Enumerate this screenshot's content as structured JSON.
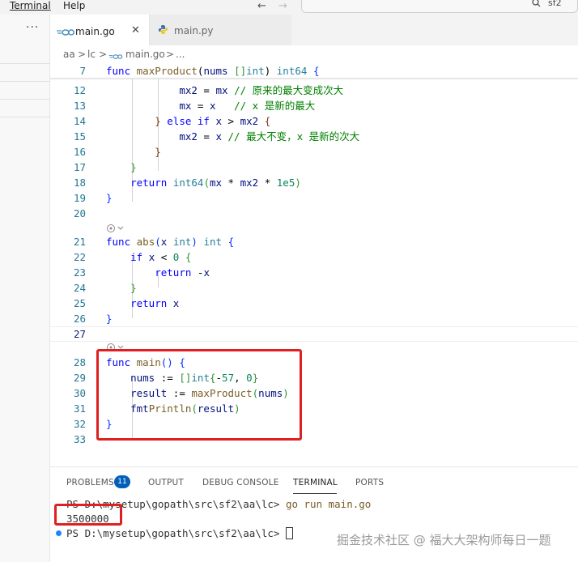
{
  "menubar": {
    "items": [
      "Terminal",
      "Help"
    ],
    "back_arrow": "←",
    "forward_arrow": "→",
    "search_text": "sf2"
  },
  "sidebar": {
    "more_label": "···"
  },
  "tabs": [
    {
      "label": "main.go",
      "icon": "go-file-icon",
      "close": "✕",
      "active": true
    },
    {
      "label": "main.py",
      "icon": "python-file-icon",
      "active": false
    }
  ],
  "breadcrumb": {
    "parts": [
      "aa",
      ">",
      "lc",
      ">",
      "main.go",
      ">",
      "..."
    ]
  },
  "editor": {
    "lines": [
      {
        "n": "7",
        "tokens": [
          [
            "kw",
            "func "
          ],
          [
            "fn",
            "maxProduct"
          ],
          [
            "",
            "("
          ],
          [
            "id",
            "nums "
          ],
          [
            "br2",
            "[]"
          ],
          [
            "ty",
            "int"
          ],
          [
            "",
            ") "
          ],
          [
            "ty",
            "int64 "
          ],
          [
            "br",
            "{"
          ]
        ]
      },
      {
        "n": "12",
        "tokens": [
          [
            "",
            "            "
          ],
          [
            "id",
            "mx2"
          ],
          [
            "",
            " = "
          ],
          [
            "id",
            "mx"
          ],
          [
            "",
            " "
          ],
          [
            "cm",
            "// 原来的最大变成次大"
          ]
        ]
      },
      {
        "n": "13",
        "tokens": [
          [
            "",
            "            "
          ],
          [
            "id",
            "mx"
          ],
          [
            "",
            " = "
          ],
          [
            "id",
            "x"
          ],
          [
            "",
            "   "
          ],
          [
            "cm",
            "// x 是新的最大"
          ]
        ]
      },
      {
        "n": "14",
        "tokens": [
          [
            "",
            "        "
          ],
          [
            "br3",
            "}"
          ],
          [
            "",
            " "
          ],
          [
            "kw",
            "else if "
          ],
          [
            "id",
            "x"
          ],
          [
            "",
            " > "
          ],
          [
            "id",
            "mx2"
          ],
          [
            "",
            " "
          ],
          [
            "br3",
            "{"
          ]
        ]
      },
      {
        "n": "15",
        "tokens": [
          [
            "",
            "            "
          ],
          [
            "id",
            "mx2"
          ],
          [
            "",
            " = "
          ],
          [
            "id",
            "x"
          ],
          [
            "",
            " "
          ],
          [
            "cm",
            "// 最大不变，x 是新的次大"
          ]
        ]
      },
      {
        "n": "16",
        "tokens": [
          [
            "",
            "        "
          ],
          [
            "br3",
            "}"
          ]
        ]
      },
      {
        "n": "17",
        "tokens": [
          [
            "",
            "    "
          ],
          [
            "br2",
            "}"
          ]
        ]
      },
      {
        "n": "18",
        "tokens": [
          [
            "",
            "    "
          ],
          [
            "kw",
            "return "
          ],
          [
            "ty",
            "int64"
          ],
          [
            "br2",
            "("
          ],
          [
            "id",
            "mx"
          ],
          [
            "",
            " * "
          ],
          [
            "id",
            "mx2"
          ],
          [
            "",
            " * "
          ],
          [
            "num",
            "1e5"
          ],
          [
            "br2",
            ")"
          ]
        ]
      },
      {
        "n": "19",
        "tokens": [
          [
            "br",
            "}"
          ]
        ]
      },
      {
        "n": "20",
        "tokens": []
      },
      {
        "n": "21",
        "tokens": [
          [
            "kw",
            "func "
          ],
          [
            "fn",
            "abs"
          ],
          [
            "br",
            "("
          ],
          [
            "id",
            "x "
          ],
          [
            "ty",
            "int"
          ],
          [
            "br",
            ") "
          ],
          [
            "ty",
            "int "
          ],
          [
            "br",
            "{"
          ]
        ]
      },
      {
        "n": "22",
        "tokens": [
          [
            "",
            "    "
          ],
          [
            "kw",
            "if "
          ],
          [
            "id",
            "x"
          ],
          [
            "",
            " < "
          ],
          [
            "num",
            "0"
          ],
          [
            "",
            " "
          ],
          [
            "br2",
            "{"
          ]
        ]
      },
      {
        "n": "23",
        "tokens": [
          [
            "",
            "        "
          ],
          [
            "kw",
            "return "
          ],
          [
            "",
            "-"
          ],
          [
            "id",
            "x"
          ]
        ]
      },
      {
        "n": "24",
        "tokens": [
          [
            "",
            "    "
          ],
          [
            "br2",
            "}"
          ]
        ]
      },
      {
        "n": "25",
        "tokens": [
          [
            "",
            "    "
          ],
          [
            "kw",
            "return "
          ],
          [
            "id",
            "x"
          ]
        ]
      },
      {
        "n": "26",
        "tokens": [
          [
            "br",
            "}"
          ]
        ]
      },
      {
        "n": "27",
        "tokens": []
      },
      {
        "n": "28",
        "tokens": [
          [
            "kw",
            "func "
          ],
          [
            "fn",
            "main"
          ],
          [
            "br",
            "() "
          ],
          [
            "br",
            "{"
          ]
        ]
      },
      {
        "n": "29",
        "tokens": [
          [
            "",
            "    "
          ],
          [
            "id",
            "nums"
          ],
          [
            "",
            " := "
          ],
          [
            "br2",
            "[]"
          ],
          [
            "ty",
            "int"
          ],
          [
            "br2",
            "{"
          ],
          [
            "",
            "-"
          ],
          [
            "num",
            "5"
          ],
          [
            ", "
          ],
          [
            "num",
            "7"
          ],
          [
            "",
            ", "
          ],
          [
            "num",
            "0"
          ],
          [
            "br2",
            "}"
          ]
        ]
      },
      {
        "n": "30",
        "tokens": [
          [
            "",
            "    "
          ],
          [
            "id",
            "result"
          ],
          [
            "",
            " := "
          ],
          [
            "fn",
            "maxProduct"
          ],
          [
            "br2",
            "("
          ],
          [
            "id",
            "nums"
          ],
          [
            "br2",
            ")"
          ]
        ]
      },
      {
        "n": "31",
        "tokens": [
          [
            "",
            "    "
          ],
          [
            "id",
            "fmt"
          ],
          [
            ".",
            ""
          ],
          [
            "fn",
            "Println"
          ],
          [
            "br2",
            "("
          ],
          [
            "id",
            "result"
          ],
          [
            "br2",
            ")"
          ]
        ]
      },
      {
        "n": "32",
        "tokens": [
          [
            "br",
            "}"
          ]
        ]
      },
      {
        "n": "33",
        "tokens": []
      }
    ]
  },
  "panel": {
    "tabs": [
      "PROBLEMS",
      "OUTPUT",
      "DEBUG CONSOLE",
      "TERMINAL",
      "PORTS"
    ],
    "problems_count": "11",
    "active_tab": "TERMINAL",
    "prompt1": "PS D:\\mysetup\\gopath\\src\\sf2\\aa\\lc> ",
    "command": "go run main.go",
    "output": "3500000",
    "prompt2": "PS D:\\mysetup\\gopath\\src\\sf2\\aa\\lc> "
  },
  "watermark": "掘金技术社区 @ 福大大架构师每日一题",
  "colors": {
    "accent": "#005fb8",
    "highlight": "#e02020"
  }
}
